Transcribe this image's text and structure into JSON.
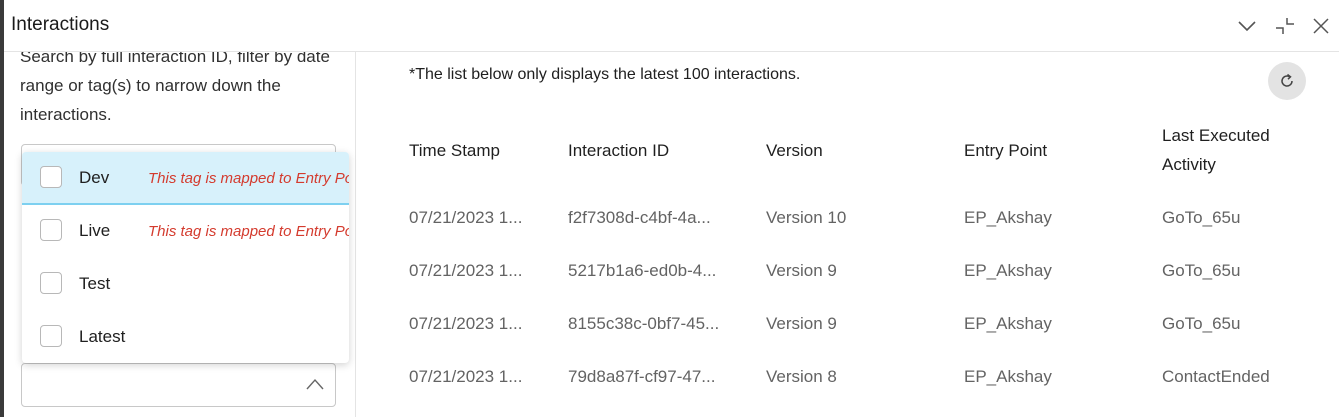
{
  "window": {
    "title": "Interactions"
  },
  "header_icons": [
    "chevron-down-icon",
    "minimize-icon",
    "close-icon"
  ],
  "filter_panel": {
    "description": "Search by full interaction ID, filter by date range or tag(s) to narrow down the interactions.",
    "tag_options": [
      {
        "label": "Dev",
        "note": "This tag is mapped to Entry Po",
        "highlighted": true
      },
      {
        "label": "Live",
        "note": "This tag is mapped to Entry Po",
        "highlighted": false
      },
      {
        "label": "Test",
        "note": "",
        "highlighted": false
      },
      {
        "label": "Latest",
        "note": "",
        "highlighted": false
      }
    ]
  },
  "list": {
    "note": "*The list below only displays the latest 100 interactions.",
    "columns": [
      "Time Stamp",
      "Interaction ID",
      "Version",
      "Entry Point",
      "Last Executed Activity"
    ],
    "rows": [
      [
        "07/21/2023 1...",
        "f2f7308d-c4bf-4a...",
        "Version 10",
        "EP_Akshay",
        "GoTo_65u"
      ],
      [
        "07/21/2023 1...",
        "5217b1a6-ed0b-4...",
        "Version 9",
        "EP_Akshay",
        "GoTo_65u"
      ],
      [
        "07/21/2023 1...",
        "8155c38c-0bf7-45...",
        "Version 9",
        "EP_Akshay",
        "GoTo_65u"
      ],
      [
        "07/21/2023 1...",
        "79d8a87f-cf97-47...",
        "Version 8",
        "EP_Akshay",
        "ContactEnded"
      ]
    ]
  },
  "colors": {
    "highlight_bg": "#d7f1fb",
    "highlight_border": "#7dd0f0",
    "note_red": "#d43b2e"
  }
}
